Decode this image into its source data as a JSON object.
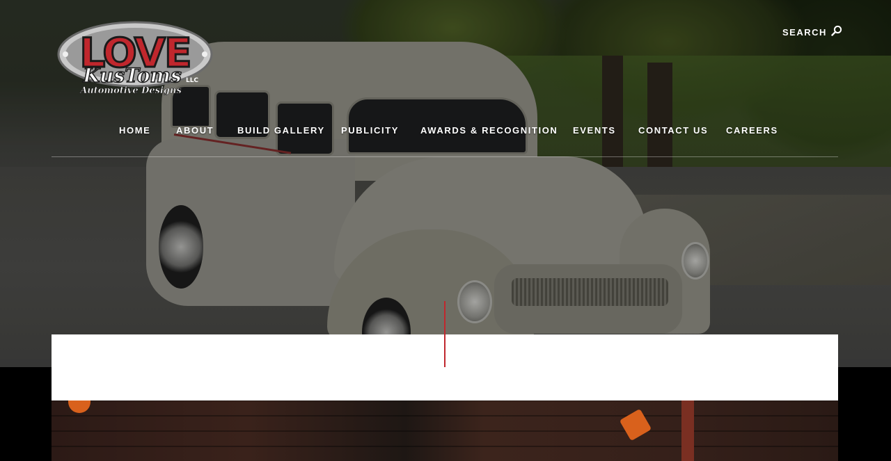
{
  "brand": {
    "logo_main": "LOVE",
    "logo_sub": "KusToms",
    "logo_suffix": "LLC",
    "logo_tagline": "Automotive Designs",
    "accent_color": "#c0272d"
  },
  "header": {
    "search_label": "SEARCH",
    "search_icon": "search-icon"
  },
  "nav": {
    "items": [
      {
        "label": "HOME"
      },
      {
        "label": "ABOUT"
      },
      {
        "label": "BUILD GALLERY"
      },
      {
        "label": "PUBLICITY"
      },
      {
        "label": "AWARDS & RECOGNITION"
      },
      {
        "label": "EVENTS"
      },
      {
        "label": "CONTACT US"
      },
      {
        "label": "CAREERS"
      }
    ]
  }
}
